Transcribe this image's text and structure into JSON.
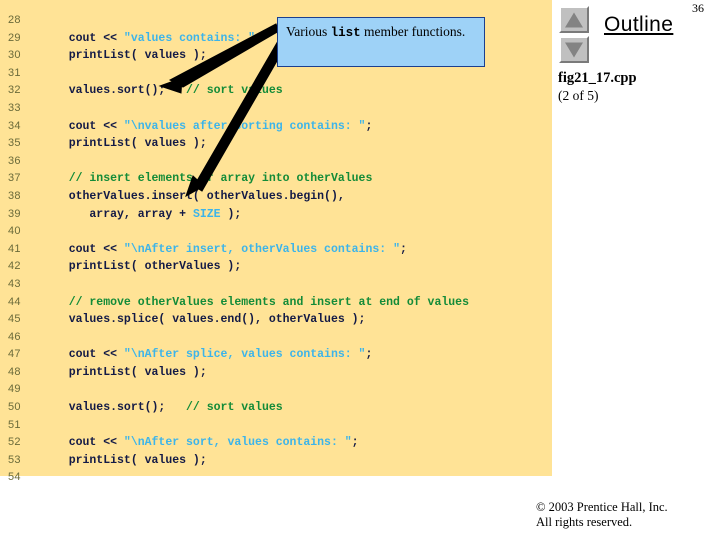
{
  "slide": {
    "page_number": "36",
    "panel_background": "#ffe396",
    "accent_string_color": "#3cb4ea",
    "accent_comment_color": "#138b38",
    "callout_fill": "#9ed2f7",
    "callout_border": "#1b3f8f"
  },
  "code": {
    "lines": [
      {
        "no": "28",
        "parts": []
      },
      {
        "no": "29",
        "parts": [
          {
            "t": "   cout << ",
            "c": "code"
          },
          {
            "t": "\"values contains: \"",
            "c": "str"
          },
          {
            "t": ";",
            "c": "code"
          }
        ]
      },
      {
        "no": "30",
        "parts": [
          {
            "t": "   printList( values );",
            "c": "code"
          }
        ]
      },
      {
        "no": "31",
        "parts": []
      },
      {
        "no": "32",
        "parts": [
          {
            "t": "   values.sort();   ",
            "c": "code"
          },
          {
            "t": "// sort values",
            "c": "com"
          }
        ]
      },
      {
        "no": "33",
        "parts": []
      },
      {
        "no": "34",
        "parts": [
          {
            "t": "   cout << ",
            "c": "code"
          },
          {
            "t": "\"\\nvalues after sorting contains: \"",
            "c": "str"
          },
          {
            "t": ";",
            "c": "code"
          }
        ]
      },
      {
        "no": "35",
        "parts": [
          {
            "t": "   printList( values );",
            "c": "code"
          }
        ]
      },
      {
        "no": "36",
        "parts": []
      },
      {
        "no": "37",
        "parts": [
          {
            "t": "   // insert elements of array into otherValues",
            "c": "com"
          }
        ]
      },
      {
        "no": "38",
        "parts": [
          {
            "t": "   otherValues.insert( otherValues.begin(),",
            "c": "code"
          }
        ]
      },
      {
        "no": "39",
        "parts": [
          {
            "t": "      array, array + ",
            "c": "code"
          },
          {
            "t": "SIZE",
            "c": "id"
          },
          {
            "t": " );",
            "c": "code"
          }
        ]
      },
      {
        "no": "40",
        "parts": []
      },
      {
        "no": "41",
        "parts": [
          {
            "t": "   cout << ",
            "c": "code"
          },
          {
            "t": "\"\\nAfter insert, otherValues contains: \"",
            "c": "str"
          },
          {
            "t": ";",
            "c": "code"
          }
        ]
      },
      {
        "no": "42",
        "parts": [
          {
            "t": "   printList( otherValues );",
            "c": "code"
          }
        ]
      },
      {
        "no": "43",
        "parts": []
      },
      {
        "no": "44",
        "parts": [
          {
            "t": "   // remove otherValues elements and insert at end of values",
            "c": "com"
          }
        ]
      },
      {
        "no": "45",
        "parts": [
          {
            "t": "   values.splice( values.end(), otherValues );",
            "c": "code"
          }
        ]
      },
      {
        "no": "46",
        "parts": []
      },
      {
        "no": "47",
        "parts": [
          {
            "t": "   cout << ",
            "c": "code"
          },
          {
            "t": "\"\\nAfter splice, values contains: \"",
            "c": "str"
          },
          {
            "t": ";",
            "c": "code"
          }
        ]
      },
      {
        "no": "48",
        "parts": [
          {
            "t": "   printList( values );",
            "c": "code"
          }
        ]
      },
      {
        "no": "49",
        "parts": []
      },
      {
        "no": "50",
        "parts": [
          {
            "t": "   values.sort();   ",
            "c": "code"
          },
          {
            "t": "// sort values",
            "c": "com"
          }
        ]
      },
      {
        "no": "51",
        "parts": []
      },
      {
        "no": "52",
        "parts": [
          {
            "t": "   cout << ",
            "c": "code"
          },
          {
            "t": "\"\\nAfter sort, values contains: \"",
            "c": "str"
          },
          {
            "t": ";",
            "c": "code"
          }
        ]
      },
      {
        "no": "53",
        "parts": [
          {
            "t": "   printList( values );",
            "c": "code"
          }
        ]
      },
      {
        "no": "54",
        "parts": []
      }
    ]
  },
  "callout": {
    "text_before": "Various ",
    "text_mono": "list",
    "text_after": " member functions."
  },
  "outline": {
    "title": "Outline",
    "up_icon": "triangle-up-icon",
    "down_icon": "triangle-down-icon",
    "file_name": "fig21_17.cpp",
    "file_part": "(2 of 5)"
  },
  "footer": {
    "line1": "© 2003 Prentice Hall, Inc.",
    "line2": "All rights reserved."
  }
}
